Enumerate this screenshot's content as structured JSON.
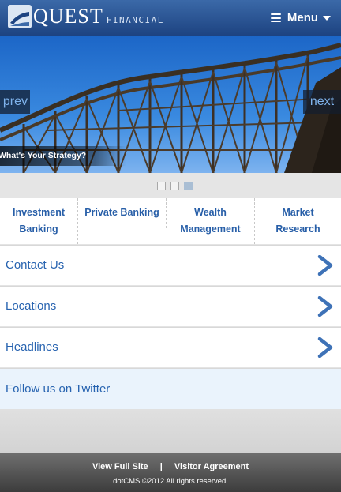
{
  "header": {
    "logo_text": "QUEST",
    "logo_sub": "FINANCIAL",
    "menu_label": "Menu"
  },
  "hero": {
    "prev_label": "prev",
    "next_label": "next",
    "caption": "What's Your Strategy?",
    "slide_count": 3,
    "active_slide": 3
  },
  "categories": [
    {
      "label": "Investment Banking"
    },
    {
      "label": "Private Banking"
    },
    {
      "label": "Wealth Management"
    },
    {
      "label": "Market Research"
    }
  ],
  "links": [
    {
      "label": "Contact Us"
    },
    {
      "label": "Locations"
    },
    {
      "label": "Headlines"
    }
  ],
  "twitter": {
    "label": "Follow us on Twitter"
  },
  "footer": {
    "view_full_site": "View Full Site",
    "separator": "|",
    "visitor_agreement": "Visitor Agreement",
    "copyright": "dotCMS ©2012 All rights reserved."
  },
  "colors": {
    "brand_blue": "#1d4381",
    "link_blue": "#2763b0",
    "twitter_bg": "#eaf3fc"
  }
}
